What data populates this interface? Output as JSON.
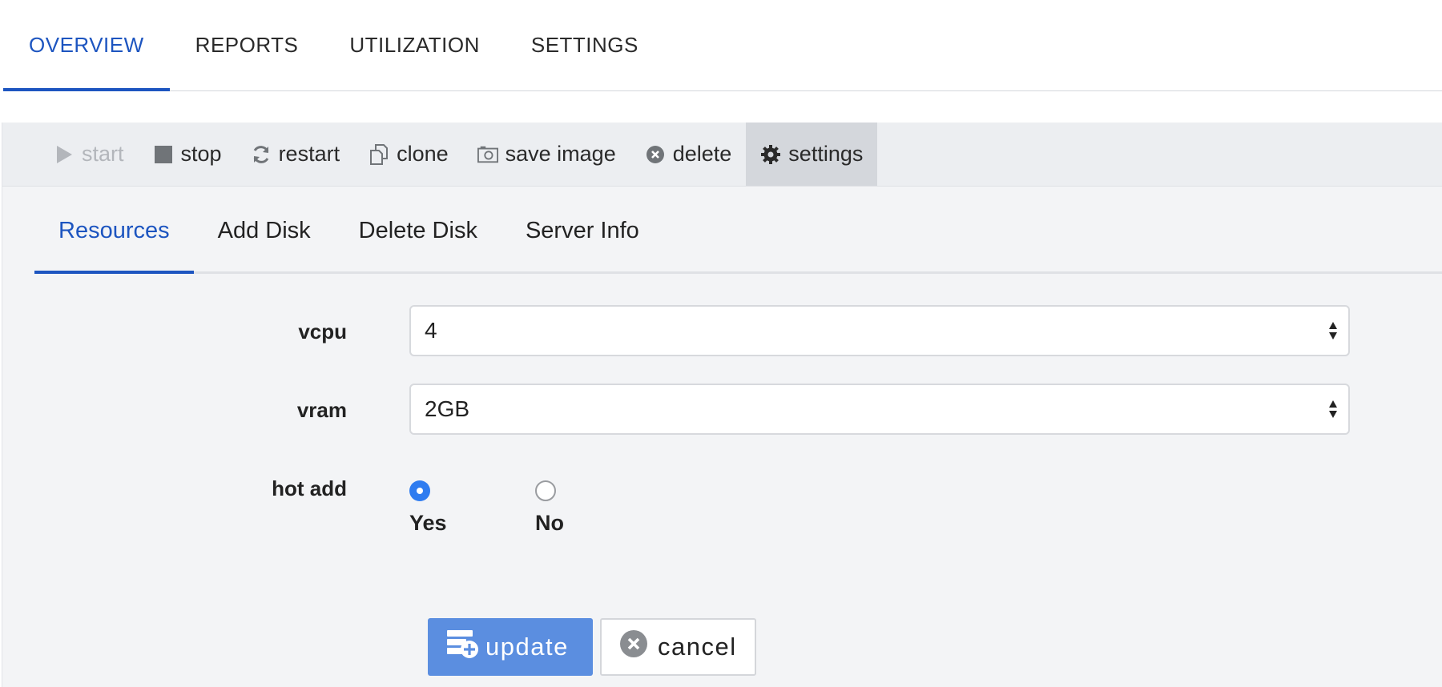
{
  "top_tabs": [
    {
      "label": "OVERVIEW",
      "active": true
    },
    {
      "label": "REPORTS",
      "active": false
    },
    {
      "label": "UTILIZATION",
      "active": false
    },
    {
      "label": "SETTINGS",
      "active": false
    }
  ],
  "toolbar": {
    "start": {
      "label": "start",
      "icon": "play-icon",
      "disabled": true
    },
    "stop": {
      "label": "stop",
      "icon": "stop-icon"
    },
    "restart": {
      "label": "restart",
      "icon": "refresh-icon"
    },
    "clone": {
      "label": "clone",
      "icon": "copy-icon"
    },
    "save_image": {
      "label": "save image",
      "icon": "camera-icon"
    },
    "delete": {
      "label": "delete",
      "icon": "close-circle-icon"
    },
    "settings": {
      "label": "settings",
      "icon": "gear-icon",
      "active": true
    }
  },
  "inner_tabs": [
    {
      "label": "Resources",
      "active": true
    },
    {
      "label": "Add Disk",
      "active": false
    },
    {
      "label": "Delete Disk",
      "active": false
    },
    {
      "label": "Server Info",
      "active": false
    }
  ],
  "form": {
    "vcpu": {
      "label": "vcpu",
      "value": "4"
    },
    "vram": {
      "label": "vram",
      "value": "2GB"
    },
    "hot_add": {
      "label": "hot add",
      "options": [
        {
          "label": "Yes",
          "checked": true
        },
        {
          "label": "No",
          "checked": false
        }
      ]
    }
  },
  "buttons": {
    "update": {
      "label": "update",
      "icon": "server-add-icon"
    },
    "cancel": {
      "label": "cancel",
      "icon": "close-circle-icon"
    }
  },
  "colors": {
    "accent": "#1d55c0",
    "primary_button": "#5b8ee0",
    "radio_checked": "#2f7cf0",
    "panel_bg": "#f3f4f6"
  }
}
